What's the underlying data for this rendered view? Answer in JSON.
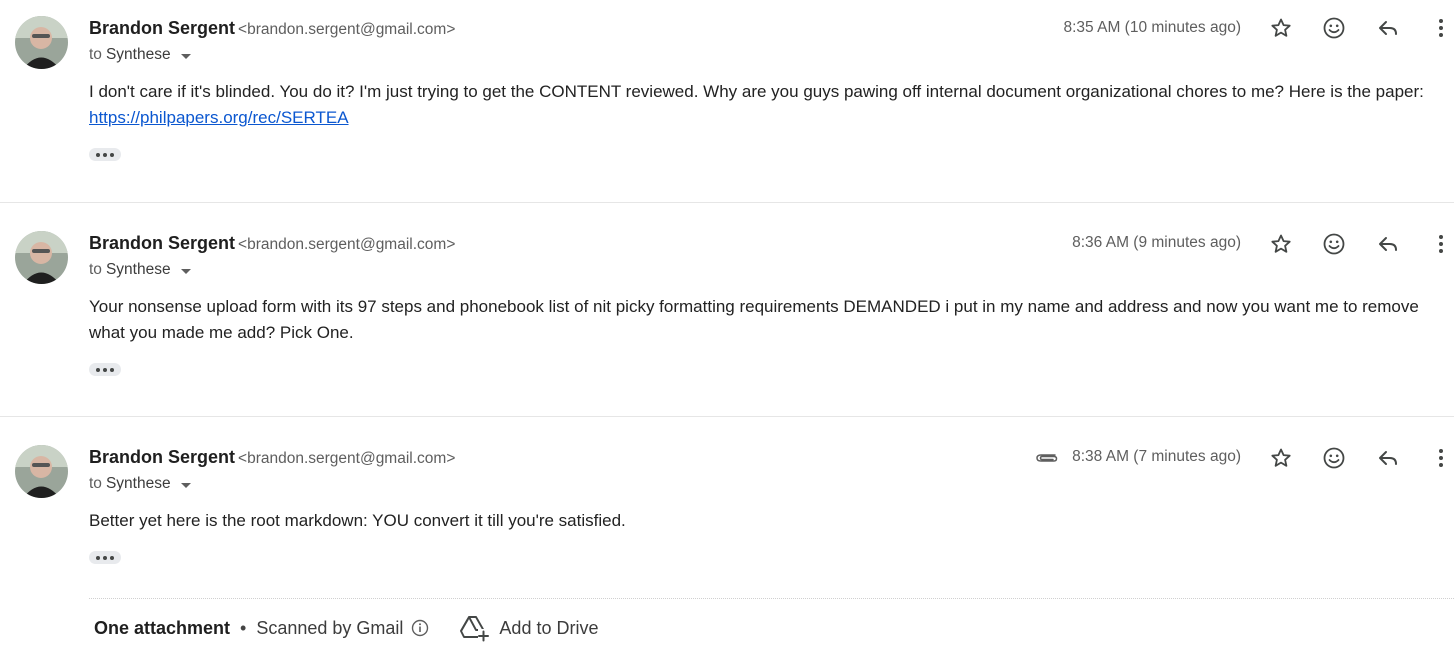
{
  "messages": [
    {
      "sender_name": "Brandon Sergent",
      "sender_email": "<brandon.sergent@gmail.com>",
      "to_prefix": "to",
      "recipient": "Synthese",
      "time": "8:35 AM (10 minutes ago)",
      "body_before_link": "I don't care if it's blinded. You do it? I'm just trying to get the CONTENT reviewed. Why are you guys pawing off internal document organizational chores to me? Here is the paper: ",
      "link_text": "https://philpapers.org/rec/SERTEA",
      "has_attachment": false
    },
    {
      "sender_name": "Brandon Sergent",
      "sender_email": "<brandon.sergent@gmail.com>",
      "to_prefix": "to",
      "recipient": "Synthese",
      "time": "8:36 AM (9 minutes ago)",
      "body": "Your nonsense upload form with its 97 steps and phonebook list of nit picky formatting requirements DEMANDED i put in my name and address and now you want me to remove what you made me add? Pick One.",
      "has_attachment": false
    },
    {
      "sender_name": "Brandon Sergent",
      "sender_email": "<brandon.sergent@gmail.com>",
      "to_prefix": "to",
      "recipient": "Synthese",
      "time": "8:38 AM (7 minutes ago)",
      "body": "Better yet here is the root markdown: YOU convert it till you're satisfied.",
      "has_attachment": true
    }
  ],
  "attachments": {
    "title": "One attachment",
    "bullet": "•",
    "scanned": "Scanned by Gmail",
    "add_to_drive": "Add to Drive"
  },
  "icons": {
    "star": "star-outline-icon",
    "emoji": "emoji-reaction-icon",
    "reply": "reply-icon",
    "more": "more-vert-icon",
    "attachment": "paperclip-icon",
    "info": "info-icon",
    "drive": "add-to-drive-icon"
  },
  "colors": {
    "link": "#0b57d0",
    "text": "#1f1f1f",
    "muted": "#5e5e5e",
    "pill": "#e8eaed"
  }
}
